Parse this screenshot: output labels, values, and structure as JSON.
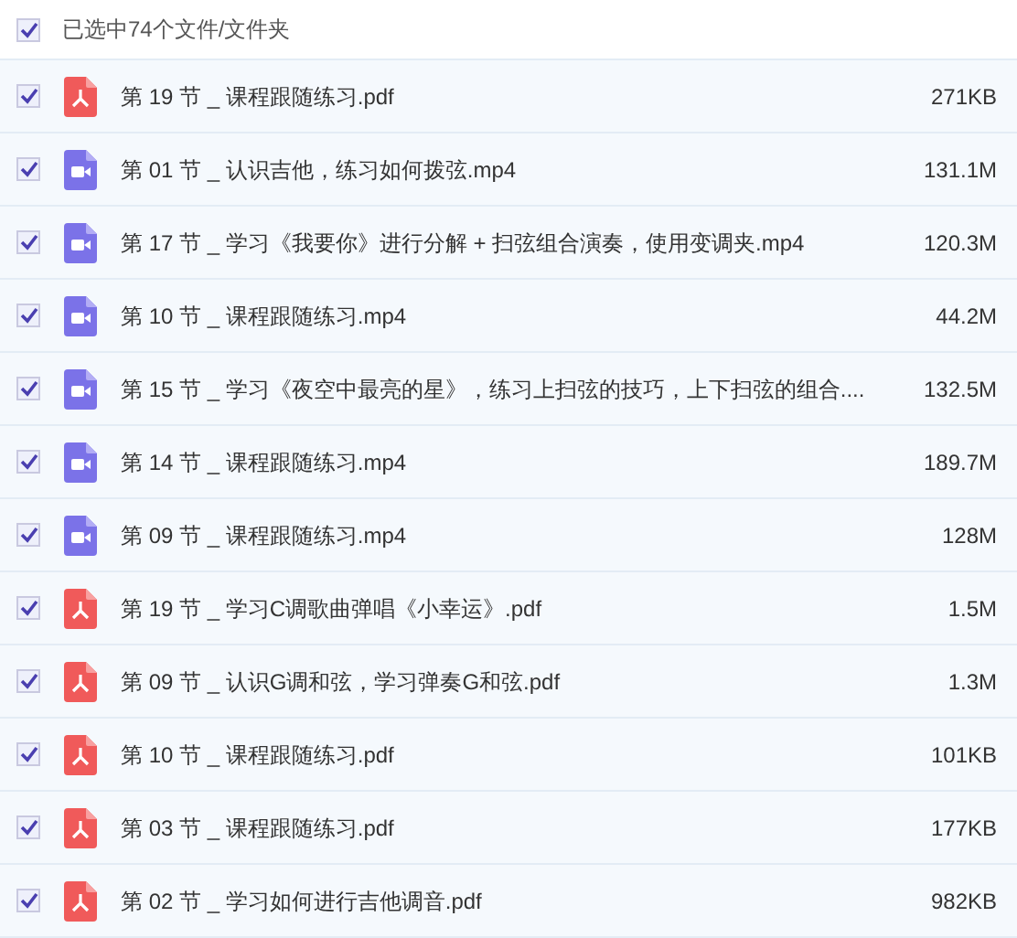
{
  "header": {
    "checked": true,
    "label": "已选中74个文件/文件夹"
  },
  "files": [
    {
      "checked": true,
      "kind": "pdf",
      "name": "第 19 节 _ 课程跟随练习.pdf",
      "size": "271KB"
    },
    {
      "checked": true,
      "kind": "video",
      "name": "第 01 节 _ 认识吉他，练习如何拨弦.mp4",
      "size": "131.1M"
    },
    {
      "checked": true,
      "kind": "video",
      "name": "第 17 节 _ 学习《我要你》进行分解 + 扫弦组合演奏，使用变调夹.mp4",
      "size": "120.3M"
    },
    {
      "checked": true,
      "kind": "video",
      "name": "第 10 节 _ 课程跟随练习.mp4",
      "size": "44.2M"
    },
    {
      "checked": true,
      "kind": "video",
      "name": "第 15 节 _ 学习《夜空中最亮的星》，练习上扫弦的技巧，上下扫弦的组合....",
      "size": "132.5M"
    },
    {
      "checked": true,
      "kind": "video",
      "name": "第 14 节 _ 课程跟随练习.mp4",
      "size": "189.7M"
    },
    {
      "checked": true,
      "kind": "video",
      "name": "第 09 节 _ 课程跟随练习.mp4",
      "size": "128M"
    },
    {
      "checked": true,
      "kind": "pdf",
      "name": "第 19 节 _ 学习C调歌曲弹唱《小幸运》.pdf",
      "size": "1.5M"
    },
    {
      "checked": true,
      "kind": "pdf",
      "name": "第 09 节 _ 认识G调和弦，学习弹奏G和弦.pdf",
      "size": "1.3M"
    },
    {
      "checked": true,
      "kind": "pdf",
      "name": "第 10 节 _ 课程跟随练习.pdf",
      "size": "101KB"
    },
    {
      "checked": true,
      "kind": "pdf",
      "name": "第 03 节 _ 课程跟随练习.pdf",
      "size": "177KB"
    },
    {
      "checked": true,
      "kind": "pdf",
      "name": "第 02 节 _ 学习如何进行吉他调音.pdf",
      "size": "982KB"
    }
  ]
}
